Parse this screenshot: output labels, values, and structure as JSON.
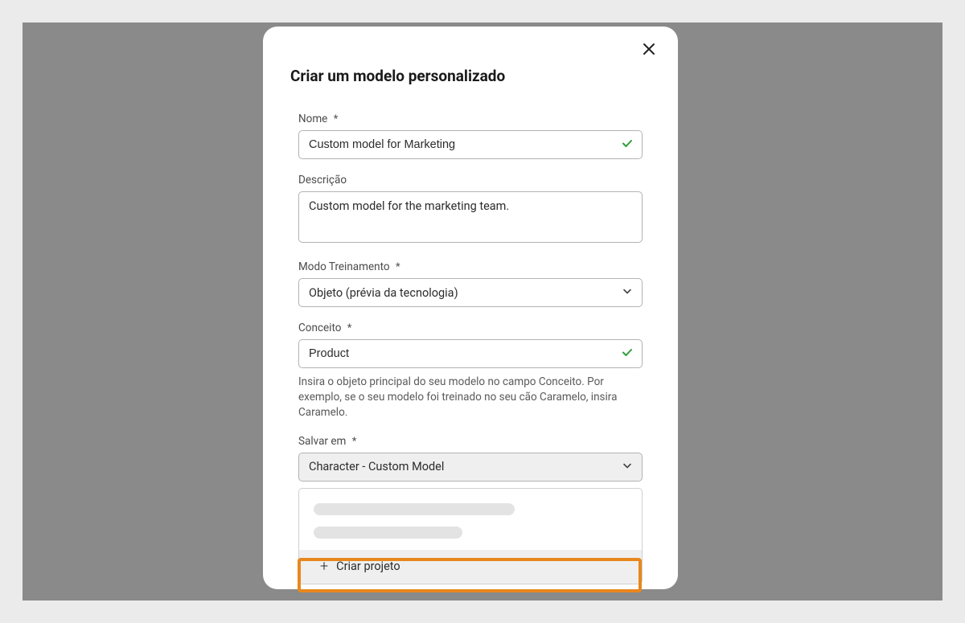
{
  "modal": {
    "title": "Criar um modelo personalizado",
    "close_aria": "Fechar"
  },
  "fields": {
    "name": {
      "label": "Nome",
      "required": "*",
      "value": "Custom model for Marketing"
    },
    "description": {
      "label": "Descrição",
      "value": "Custom model for the marketing team."
    },
    "training_mode": {
      "label": "Modo Treinamento",
      "required": "*",
      "value": "Objeto (prévia da tecnologia)"
    },
    "concept": {
      "label": "Conceito",
      "required": "*",
      "value": "Product",
      "helper": "Insira o objeto principal do seu modelo no campo Conceito. Por exemplo, se o seu modelo foi treinado no seu cão Caramelo, insira Caramelo."
    },
    "save_in": {
      "label": "Salvar em",
      "required": "*",
      "value": "Character - Custom Model",
      "create_project": "Criar projeto"
    }
  },
  "colors": {
    "check": "#2d9d3a",
    "highlight": "#e8871e"
  }
}
